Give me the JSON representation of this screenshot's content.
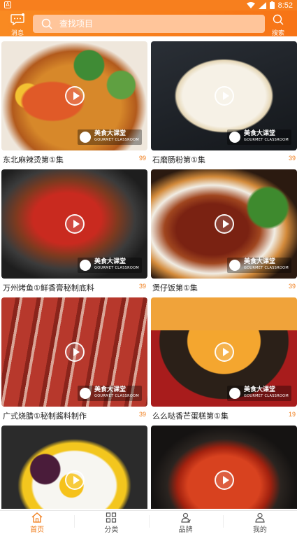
{
  "statusbar": {
    "app_indicator": "A",
    "time": "8:52"
  },
  "header": {
    "message_label": "消息",
    "search_placeholder": "查找项目",
    "search_label": "搜索"
  },
  "colors": {
    "accent": "#f77f1e",
    "count": "#f07d1a",
    "search_bg": "#ffc59a"
  },
  "badge": {
    "line1": "美食大课堂",
    "line2": "GOURMET CLASSROOM"
  },
  "courses": [
    {
      "title": "东北麻辣烫第①集",
      "count": "99"
    },
    {
      "title": "石磨肠粉第①集",
      "count": "39"
    },
    {
      "title": "万州烤鱼①鲜香膏秘制底料",
      "count": "39"
    },
    {
      "title": "煲仔饭第①集",
      "count": "39"
    },
    {
      "title": "广式烧腊①秘制酱料制作",
      "count": "39"
    },
    {
      "title": "么么哒香芒蛋糕第①集",
      "count": "19"
    },
    {
      "title": "",
      "count": ""
    },
    {
      "title": "",
      "count": ""
    }
  ],
  "tabs": [
    {
      "label": "首页",
      "icon": "home-icon",
      "active": true
    },
    {
      "label": "分类",
      "icon": "grid-icon",
      "active": false
    },
    {
      "label": "品牌",
      "icon": "brand-icon",
      "active": false
    },
    {
      "label": "我的",
      "icon": "user-icon",
      "active": false
    }
  ]
}
